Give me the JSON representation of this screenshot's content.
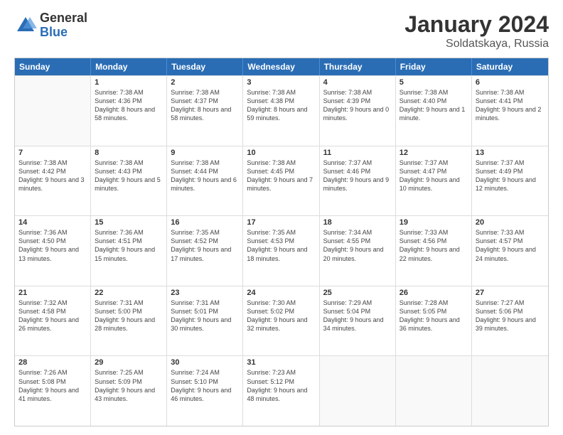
{
  "header": {
    "logo_general": "General",
    "logo_blue": "Blue",
    "title": "January 2024",
    "location": "Soldatskaya, Russia"
  },
  "calendar": {
    "days_of_week": [
      "Sunday",
      "Monday",
      "Tuesday",
      "Wednesday",
      "Thursday",
      "Friday",
      "Saturday"
    ],
    "weeks": [
      [
        {
          "day": "",
          "empty": true
        },
        {
          "day": "1",
          "sunrise": "7:38 AM",
          "sunset": "4:36 PM",
          "daylight": "8 hours and 58 minutes."
        },
        {
          "day": "2",
          "sunrise": "7:38 AM",
          "sunset": "4:37 PM",
          "daylight": "8 hours and 58 minutes."
        },
        {
          "day": "3",
          "sunrise": "7:38 AM",
          "sunset": "4:38 PM",
          "daylight": "8 hours and 59 minutes."
        },
        {
          "day": "4",
          "sunrise": "7:38 AM",
          "sunset": "4:39 PM",
          "daylight": "9 hours and 0 minutes."
        },
        {
          "day": "5",
          "sunrise": "7:38 AM",
          "sunset": "4:40 PM",
          "daylight": "9 hours and 1 minute."
        },
        {
          "day": "6",
          "sunrise": "7:38 AM",
          "sunset": "4:41 PM",
          "daylight": "9 hours and 2 minutes."
        }
      ],
      [
        {
          "day": "7",
          "sunrise": "7:38 AM",
          "sunset": "4:42 PM",
          "daylight": "9 hours and 3 minutes."
        },
        {
          "day": "8",
          "sunrise": "7:38 AM",
          "sunset": "4:43 PM",
          "daylight": "9 hours and 5 minutes."
        },
        {
          "day": "9",
          "sunrise": "7:38 AM",
          "sunset": "4:44 PM",
          "daylight": "9 hours and 6 minutes."
        },
        {
          "day": "10",
          "sunrise": "7:38 AM",
          "sunset": "4:45 PM",
          "daylight": "9 hours and 7 minutes."
        },
        {
          "day": "11",
          "sunrise": "7:37 AM",
          "sunset": "4:46 PM",
          "daylight": "9 hours and 9 minutes."
        },
        {
          "day": "12",
          "sunrise": "7:37 AM",
          "sunset": "4:47 PM",
          "daylight": "9 hours and 10 minutes."
        },
        {
          "day": "13",
          "sunrise": "7:37 AM",
          "sunset": "4:49 PM",
          "daylight": "9 hours and 12 minutes."
        }
      ],
      [
        {
          "day": "14",
          "sunrise": "7:36 AM",
          "sunset": "4:50 PM",
          "daylight": "9 hours and 13 minutes."
        },
        {
          "day": "15",
          "sunrise": "7:36 AM",
          "sunset": "4:51 PM",
          "daylight": "9 hours and 15 minutes."
        },
        {
          "day": "16",
          "sunrise": "7:35 AM",
          "sunset": "4:52 PM",
          "daylight": "9 hours and 17 minutes."
        },
        {
          "day": "17",
          "sunrise": "7:35 AM",
          "sunset": "4:53 PM",
          "daylight": "9 hours and 18 minutes."
        },
        {
          "day": "18",
          "sunrise": "7:34 AM",
          "sunset": "4:55 PM",
          "daylight": "9 hours and 20 minutes."
        },
        {
          "day": "19",
          "sunrise": "7:33 AM",
          "sunset": "4:56 PM",
          "daylight": "9 hours and 22 minutes."
        },
        {
          "day": "20",
          "sunrise": "7:33 AM",
          "sunset": "4:57 PM",
          "daylight": "9 hours and 24 minutes."
        }
      ],
      [
        {
          "day": "21",
          "sunrise": "7:32 AM",
          "sunset": "4:58 PM",
          "daylight": "9 hours and 26 minutes."
        },
        {
          "day": "22",
          "sunrise": "7:31 AM",
          "sunset": "5:00 PM",
          "daylight": "9 hours and 28 minutes."
        },
        {
          "day": "23",
          "sunrise": "7:31 AM",
          "sunset": "5:01 PM",
          "daylight": "9 hours and 30 minutes."
        },
        {
          "day": "24",
          "sunrise": "7:30 AM",
          "sunset": "5:02 PM",
          "daylight": "9 hours and 32 minutes."
        },
        {
          "day": "25",
          "sunrise": "7:29 AM",
          "sunset": "5:04 PM",
          "daylight": "9 hours and 34 minutes."
        },
        {
          "day": "26",
          "sunrise": "7:28 AM",
          "sunset": "5:05 PM",
          "daylight": "9 hours and 36 minutes."
        },
        {
          "day": "27",
          "sunrise": "7:27 AM",
          "sunset": "5:06 PM",
          "daylight": "9 hours and 39 minutes."
        }
      ],
      [
        {
          "day": "28",
          "sunrise": "7:26 AM",
          "sunset": "5:08 PM",
          "daylight": "9 hours and 41 minutes."
        },
        {
          "day": "29",
          "sunrise": "7:25 AM",
          "sunset": "5:09 PM",
          "daylight": "9 hours and 43 minutes."
        },
        {
          "day": "30",
          "sunrise": "7:24 AM",
          "sunset": "5:10 PM",
          "daylight": "9 hours and 46 minutes."
        },
        {
          "day": "31",
          "sunrise": "7:23 AM",
          "sunset": "5:12 PM",
          "daylight": "9 hours and 48 minutes."
        },
        {
          "day": "",
          "empty": true
        },
        {
          "day": "",
          "empty": true
        },
        {
          "day": "",
          "empty": true
        }
      ]
    ]
  }
}
